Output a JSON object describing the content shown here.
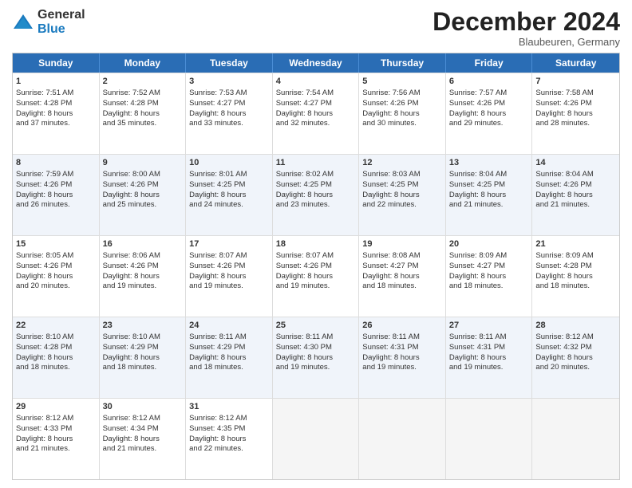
{
  "header": {
    "logo_general": "General",
    "logo_blue": "Blue",
    "month_title": "December 2024",
    "location": "Blaubeuren, Germany"
  },
  "days_of_week": [
    "Sunday",
    "Monday",
    "Tuesday",
    "Wednesday",
    "Thursday",
    "Friday",
    "Saturday"
  ],
  "weeks": [
    [
      {
        "day": "1",
        "lines": [
          "Sunrise: 7:51 AM",
          "Sunset: 4:28 PM",
          "Daylight: 8 hours",
          "and 37 minutes."
        ]
      },
      {
        "day": "2",
        "lines": [
          "Sunrise: 7:52 AM",
          "Sunset: 4:28 PM",
          "Daylight: 8 hours",
          "and 35 minutes."
        ]
      },
      {
        "day": "3",
        "lines": [
          "Sunrise: 7:53 AM",
          "Sunset: 4:27 PM",
          "Daylight: 8 hours",
          "and 33 minutes."
        ]
      },
      {
        "day": "4",
        "lines": [
          "Sunrise: 7:54 AM",
          "Sunset: 4:27 PM",
          "Daylight: 8 hours",
          "and 32 minutes."
        ]
      },
      {
        "day": "5",
        "lines": [
          "Sunrise: 7:56 AM",
          "Sunset: 4:26 PM",
          "Daylight: 8 hours",
          "and 30 minutes."
        ]
      },
      {
        "day": "6",
        "lines": [
          "Sunrise: 7:57 AM",
          "Sunset: 4:26 PM",
          "Daylight: 8 hours",
          "and 29 minutes."
        ]
      },
      {
        "day": "7",
        "lines": [
          "Sunrise: 7:58 AM",
          "Sunset: 4:26 PM",
          "Daylight: 8 hours",
          "and 28 minutes."
        ]
      }
    ],
    [
      {
        "day": "8",
        "lines": [
          "Sunrise: 7:59 AM",
          "Sunset: 4:26 PM",
          "Daylight: 8 hours",
          "and 26 minutes."
        ]
      },
      {
        "day": "9",
        "lines": [
          "Sunrise: 8:00 AM",
          "Sunset: 4:26 PM",
          "Daylight: 8 hours",
          "and 25 minutes."
        ]
      },
      {
        "day": "10",
        "lines": [
          "Sunrise: 8:01 AM",
          "Sunset: 4:25 PM",
          "Daylight: 8 hours",
          "and 24 minutes."
        ]
      },
      {
        "day": "11",
        "lines": [
          "Sunrise: 8:02 AM",
          "Sunset: 4:25 PM",
          "Daylight: 8 hours",
          "and 23 minutes."
        ]
      },
      {
        "day": "12",
        "lines": [
          "Sunrise: 8:03 AM",
          "Sunset: 4:25 PM",
          "Daylight: 8 hours",
          "and 22 minutes."
        ]
      },
      {
        "day": "13",
        "lines": [
          "Sunrise: 8:04 AM",
          "Sunset: 4:25 PM",
          "Daylight: 8 hours",
          "and 21 minutes."
        ]
      },
      {
        "day": "14",
        "lines": [
          "Sunrise: 8:04 AM",
          "Sunset: 4:26 PM",
          "Daylight: 8 hours",
          "and 21 minutes."
        ]
      }
    ],
    [
      {
        "day": "15",
        "lines": [
          "Sunrise: 8:05 AM",
          "Sunset: 4:26 PM",
          "Daylight: 8 hours",
          "and 20 minutes."
        ]
      },
      {
        "day": "16",
        "lines": [
          "Sunrise: 8:06 AM",
          "Sunset: 4:26 PM",
          "Daylight: 8 hours",
          "and 19 minutes."
        ]
      },
      {
        "day": "17",
        "lines": [
          "Sunrise: 8:07 AM",
          "Sunset: 4:26 PM",
          "Daylight: 8 hours",
          "and 19 minutes."
        ]
      },
      {
        "day": "18",
        "lines": [
          "Sunrise: 8:07 AM",
          "Sunset: 4:26 PM",
          "Daylight: 8 hours",
          "and 19 minutes."
        ]
      },
      {
        "day": "19",
        "lines": [
          "Sunrise: 8:08 AM",
          "Sunset: 4:27 PM",
          "Daylight: 8 hours",
          "and 18 minutes."
        ]
      },
      {
        "day": "20",
        "lines": [
          "Sunrise: 8:09 AM",
          "Sunset: 4:27 PM",
          "Daylight: 8 hours",
          "and 18 minutes."
        ]
      },
      {
        "day": "21",
        "lines": [
          "Sunrise: 8:09 AM",
          "Sunset: 4:28 PM",
          "Daylight: 8 hours",
          "and 18 minutes."
        ]
      }
    ],
    [
      {
        "day": "22",
        "lines": [
          "Sunrise: 8:10 AM",
          "Sunset: 4:28 PM",
          "Daylight: 8 hours",
          "and 18 minutes."
        ]
      },
      {
        "day": "23",
        "lines": [
          "Sunrise: 8:10 AM",
          "Sunset: 4:29 PM",
          "Daylight: 8 hours",
          "and 18 minutes."
        ]
      },
      {
        "day": "24",
        "lines": [
          "Sunrise: 8:11 AM",
          "Sunset: 4:29 PM",
          "Daylight: 8 hours",
          "and 18 minutes."
        ]
      },
      {
        "day": "25",
        "lines": [
          "Sunrise: 8:11 AM",
          "Sunset: 4:30 PM",
          "Daylight: 8 hours",
          "and 19 minutes."
        ]
      },
      {
        "day": "26",
        "lines": [
          "Sunrise: 8:11 AM",
          "Sunset: 4:31 PM",
          "Daylight: 8 hours",
          "and 19 minutes."
        ]
      },
      {
        "day": "27",
        "lines": [
          "Sunrise: 8:11 AM",
          "Sunset: 4:31 PM",
          "Daylight: 8 hours",
          "and 19 minutes."
        ]
      },
      {
        "day": "28",
        "lines": [
          "Sunrise: 8:12 AM",
          "Sunset: 4:32 PM",
          "Daylight: 8 hours",
          "and 20 minutes."
        ]
      }
    ],
    [
      {
        "day": "29",
        "lines": [
          "Sunrise: 8:12 AM",
          "Sunset: 4:33 PM",
          "Daylight: 8 hours",
          "and 21 minutes."
        ]
      },
      {
        "day": "30",
        "lines": [
          "Sunrise: 8:12 AM",
          "Sunset: 4:34 PM",
          "Daylight: 8 hours",
          "and 21 minutes."
        ]
      },
      {
        "day": "31",
        "lines": [
          "Sunrise: 8:12 AM",
          "Sunset: 4:35 PM",
          "Daylight: 8 hours",
          "and 22 minutes."
        ]
      },
      {
        "day": "",
        "lines": []
      },
      {
        "day": "",
        "lines": []
      },
      {
        "day": "",
        "lines": []
      },
      {
        "day": "",
        "lines": []
      }
    ]
  ]
}
